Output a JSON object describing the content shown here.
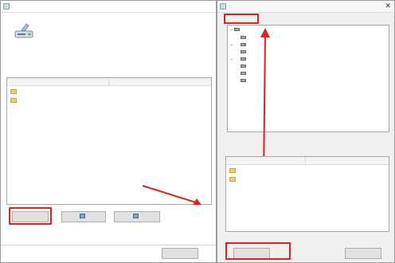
{
  "left": {
    "title": "",
    "path_line": "",
    "desc_line": "",
    "section_label": "",
    "columns": [
      "",
      ""
    ],
    "rows": [
      {
        "name": "",
        "path": ""
      },
      {
        "name": "",
        "path": ""
      }
    ],
    "buttons": [
      {
        "label": "",
        "icon": "none"
      },
      {
        "label": "",
        "icon": "refresh-icon"
      },
      {
        "label": "",
        "icon": "refresh-icon"
      }
    ],
    "link1": "",
    "link2": "",
    "bottom_button": ""
  },
  "right": {
    "title": "",
    "location_label": "",
    "tree": [
      {
        "label": "",
        "level": 0
      },
      {
        "label": "",
        "level": 1
      },
      {
        "label": "",
        "level": 1
      },
      {
        "label": "",
        "level": 1
      },
      {
        "label": "",
        "level": 1
      },
      {
        "label": "",
        "level": 1
      },
      {
        "label": "",
        "level": 1
      },
      {
        "label": "",
        "level": 1
      }
    ],
    "list_label": "",
    "columns": [
      "",
      ""
    ],
    "rows": [
      {
        "name": "",
        "path": ""
      },
      {
        "name": "",
        "path": ""
      }
    ],
    "ok_button": "",
    "cancel_button": ""
  },
  "colors": {
    "highlight": "#e12020",
    "link": "#1e5bc6",
    "folder": "#f2cd62"
  }
}
